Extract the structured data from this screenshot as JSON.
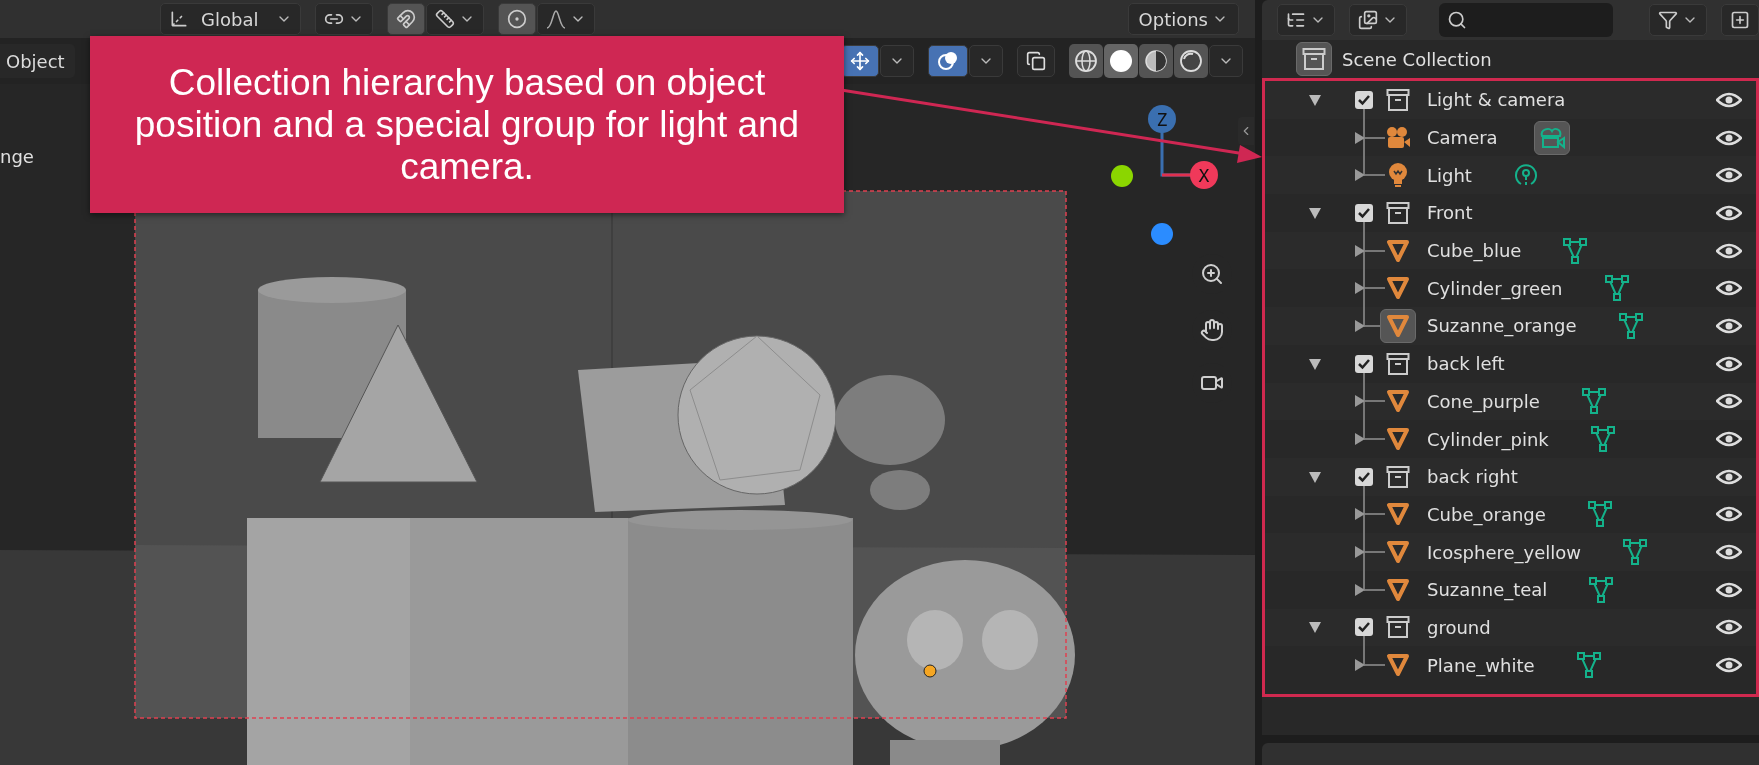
{
  "header": {
    "orientation": "Global",
    "toggles": [
      {
        "kind": "snap",
        "on": true
      },
      {
        "kind": "proportional",
        "on": true
      }
    ],
    "options": "Options"
  },
  "viewport": {
    "mode": "Object",
    "overlay_text": "nge",
    "toggles": [
      {
        "kind": "gizmo",
        "on": true
      },
      {
        "kind": "overlays",
        "on": true
      },
      {
        "kind": "xray",
        "on": false
      }
    ],
    "shading": [
      {
        "kind": "wireframe",
        "selected": false
      },
      {
        "kind": "solid",
        "selected": true
      },
      {
        "kind": "material",
        "selected": false
      },
      {
        "kind": "rendered",
        "selected": false
      }
    ],
    "gizmo_axes": [
      "Z",
      "X"
    ]
  },
  "annotation": {
    "text": "Collection hierarchy based on object position and a special group for light and camera."
  },
  "outliner": {
    "root": "Scene Collection",
    "collections": [
      {
        "name": "Light & camera",
        "expanded": true,
        "checked": true,
        "children": [
          {
            "name": "Camera",
            "kind": "camera",
            "object_highlighted": false,
            "data_highlighted": true
          },
          {
            "name": "Light",
            "kind": "light",
            "object_highlighted": false,
            "data_highlighted": false
          }
        ]
      },
      {
        "name": "Front",
        "expanded": true,
        "checked": true,
        "children": [
          {
            "name": "Cube_blue",
            "kind": "mesh",
            "object_highlighted": false,
            "data_highlighted": false
          },
          {
            "name": "Cylinder_green",
            "kind": "mesh",
            "object_highlighted": false,
            "data_highlighted": false
          },
          {
            "name": "Suzanne_orange",
            "kind": "mesh",
            "object_highlighted": true,
            "data_highlighted": false
          }
        ]
      },
      {
        "name": "back left",
        "expanded": true,
        "checked": true,
        "children": [
          {
            "name": "Cone_purple",
            "kind": "mesh",
            "object_highlighted": false,
            "data_highlighted": false
          },
          {
            "name": "Cylinder_pink",
            "kind": "mesh",
            "object_highlighted": false,
            "data_highlighted": false
          }
        ]
      },
      {
        "name": "back right",
        "expanded": true,
        "checked": true,
        "children": [
          {
            "name": "Cube_orange",
            "kind": "mesh",
            "object_highlighted": false,
            "data_highlighted": false
          },
          {
            "name": "Icosphere_yellow",
            "kind": "mesh",
            "object_highlighted": false,
            "data_highlighted": false
          },
          {
            "name": "Suzanne_teal",
            "kind": "mesh",
            "object_highlighted": false,
            "data_highlighted": false
          }
        ]
      },
      {
        "name": "ground",
        "expanded": true,
        "checked": true,
        "children": [
          {
            "name": "Plane_white",
            "kind": "mesh",
            "object_highlighted": false,
            "data_highlighted": false
          }
        ]
      }
    ]
  }
}
